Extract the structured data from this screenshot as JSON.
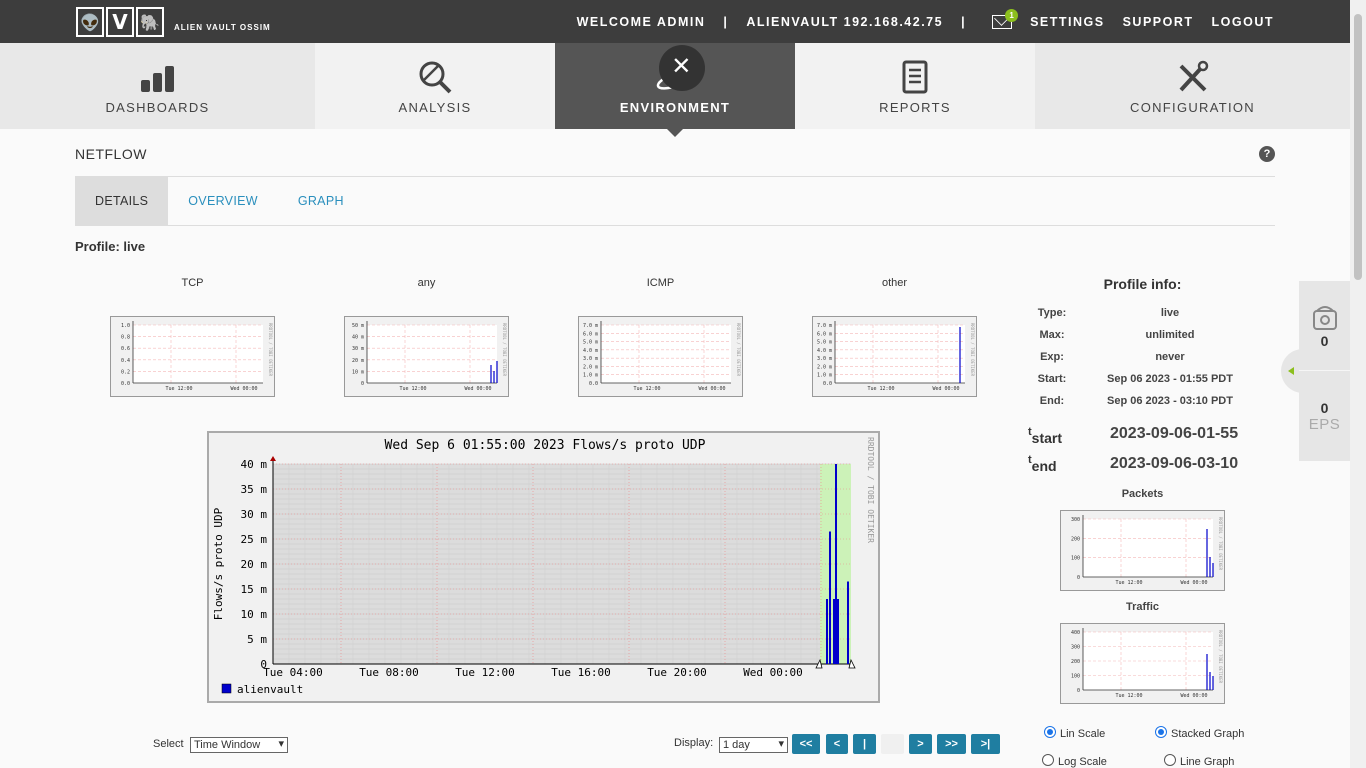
{
  "header": {
    "logo_letters": [
      "👽",
      "V",
      "🐘"
    ],
    "logo_text": "ALIEN VAULT OSSIM",
    "welcome": "WELCOME ADMIN",
    "separator": "|",
    "server": "ALIENVAULT 192.168.42.75",
    "mail_count": "1",
    "settings": "SETTINGS",
    "support": "SUPPORT",
    "logout": "LOGOUT",
    "mail_icon": "envelope-icon"
  },
  "nav": {
    "items": [
      {
        "label": "DASHBOARDS",
        "icon": "bar-chart-icon"
      },
      {
        "label": "ANALYSIS",
        "icon": "magnifier-icon"
      },
      {
        "label": "ENVIRONMENT",
        "icon": "planet-icon"
      },
      {
        "label": "REPORTS",
        "icon": "document-icon"
      },
      {
        "label": "CONFIGURATION",
        "icon": "tools-icon"
      }
    ],
    "close_glyph": "✕"
  },
  "page": {
    "title": "NETFLOW",
    "help": "?",
    "tabs": [
      "DETAILS",
      "OVERVIEW",
      "GRAPH"
    ],
    "profile_label": "Profile: live"
  },
  "thumbs": [
    {
      "title": "TCP",
      "yticks": [
        "1.0",
        "0.8",
        "0.6",
        "0.4",
        "0.2",
        "0.0"
      ]
    },
    {
      "title": "any",
      "yticks": [
        "50 m",
        "40 m",
        "30 m",
        "20 m",
        "10 m",
        "0"
      ]
    },
    {
      "title": "ICMP",
      "yticks": [
        "7.0 m",
        "6.0 m",
        "5.0 m",
        "4.0 m",
        "3.0 m",
        "2.0 m",
        "1.0 m",
        "0.0"
      ]
    },
    {
      "title": "other",
      "yticks": [
        "7.0 m",
        "6.0 m",
        "5.0 m",
        "4.0 m",
        "3.0 m",
        "2.0 m",
        "1.0 m",
        "0.0"
      ]
    }
  ],
  "thumb_xticks": [
    "Tue 12:00",
    "Wed 00:00"
  ],
  "thumb_side": "RRDTOOL / TOBI OETIKER",
  "chart_data": {
    "type": "bar",
    "title": "Wed Sep  6 01:55:00 2023 Flows/s proto UDP",
    "ylabel": "Flows/s proto UDP",
    "side_label": "RRDTOOL / TOBI OETIKER",
    "ylim": [
      0,
      40
    ],
    "yticks": [
      "40 m",
      "35 m",
      "30 m",
      "25 m",
      "20 m",
      "15 m",
      "10 m",
      "5 m",
      "0"
    ],
    "xticks": [
      "Tue 04:00",
      "Tue 08:00",
      "Tue 12:00",
      "Tue 16:00",
      "Tue 20:00",
      "Wed 00:00"
    ],
    "series": [
      {
        "name": "alienvault",
        "values": [
          13,
          26.5,
          13,
          40,
          13,
          16.5
        ]
      }
    ],
    "grid": true,
    "legend": "bottom-left",
    "color": "#0000cc"
  },
  "profile_info": {
    "title": "Profile info:",
    "rows": [
      {
        "key": "Type:",
        "value": "live"
      },
      {
        "key": "Max:",
        "value": "unlimited"
      },
      {
        "key": "Exp:",
        "value": "never"
      },
      {
        "key": "Start:",
        "value": "Sep 06 2023 - 01:55 PDT"
      },
      {
        "key": "End:",
        "value": "Sep 06 2023 - 03:10 PDT"
      }
    ],
    "t": "t",
    "tstart_sub": "start",
    "tend_sub": "end",
    "tstart": "2023-09-06-01-55",
    "tend": "2023-09-06-03-10",
    "packets_title": "Packets",
    "traffic_title": "Traffic",
    "packets_yticks": [
      "300",
      "200",
      "100",
      "0"
    ],
    "traffic_yticks": [
      "400",
      "300",
      "200",
      "100",
      "0"
    ]
  },
  "side_widget": {
    "count": "0",
    "eps_count": "0",
    "eps_label": "EPS",
    "icon": "disk-icon"
  },
  "controls": {
    "select_label": "Select",
    "select_value": "Time Window",
    "display_label": "Display:",
    "display_value": "1 day",
    "buttons": [
      "<<",
      "<",
      "|",
      "",
      ">",
      ">>",
      ">|"
    ],
    "lin_scale": "Lin Scale",
    "log_scale": "Log Scale",
    "stacked_graph": "Stacked Graph",
    "line_graph": "Line Graph"
  }
}
